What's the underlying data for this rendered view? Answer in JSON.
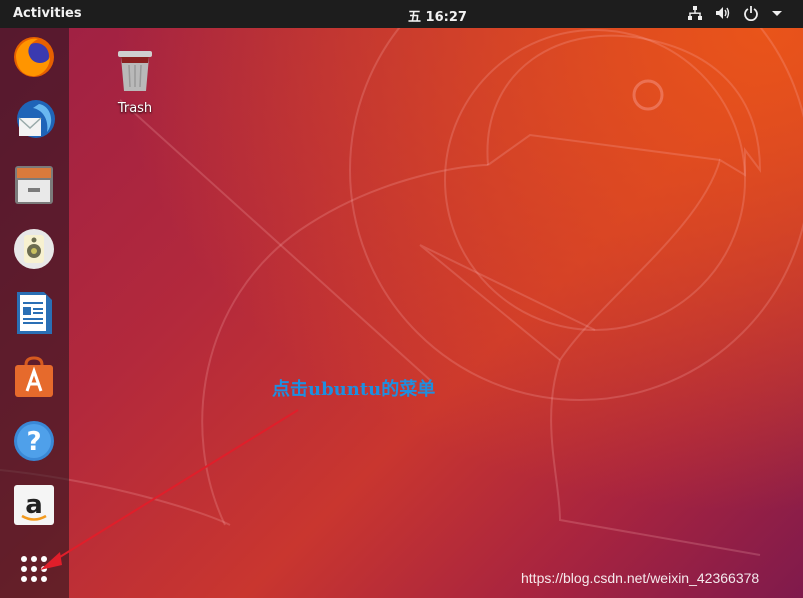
{
  "topbar": {
    "activities_label": "Activities",
    "clock": "五 16:27"
  },
  "tray_icons": [
    "network-icon",
    "volume-icon",
    "power-icon",
    "dropdown-arrow-icon"
  ],
  "dock": {
    "items": [
      {
        "name": "Firefox",
        "icon": "firefox-icon"
      },
      {
        "name": "Thunderbird",
        "icon": "thunderbird-icon"
      },
      {
        "name": "Files",
        "icon": "files-icon"
      },
      {
        "name": "Rhythmbox",
        "icon": "rhythmbox-icon"
      },
      {
        "name": "LibreOffice Writer",
        "icon": "libreoffice-writer-icon"
      },
      {
        "name": "Ubuntu Software",
        "icon": "ubuntu-software-icon"
      },
      {
        "name": "Help",
        "icon": "help-icon"
      },
      {
        "name": "Amazon",
        "icon": "amazon-icon"
      },
      {
        "name": "Show Applications",
        "icon": "show-applications-icon"
      }
    ]
  },
  "desktop": {
    "trash_label": "Trash"
  },
  "annotation": {
    "text": "点击ubuntu的菜单"
  },
  "watermark": "https://blog.csdn.net/weixin_42366378",
  "colors": {
    "topbar": "#1d1d1d",
    "annotation_text": "#1e8fe0",
    "arrow": "#e01e2a",
    "wallpaper_orange": "#e9541a",
    "wallpaper_purple": "#9c1f45"
  }
}
